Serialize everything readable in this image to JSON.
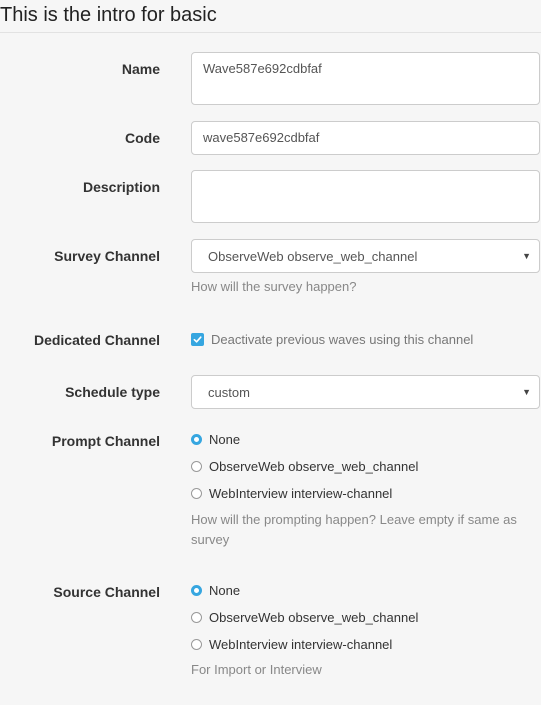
{
  "header": {
    "title": "This is the intro for basic"
  },
  "form": {
    "name": {
      "label": "Name",
      "value": "Wave587e692cdbfaf"
    },
    "code": {
      "label": "Code",
      "value": "wave587e692cdbfaf"
    },
    "description": {
      "label": "Description",
      "value": ""
    },
    "survey_channel": {
      "label": "Survey Channel",
      "selected": "ObserveWeb observe_web_channel",
      "help": "How will the survey happen?"
    },
    "dedicated_channel": {
      "label": "Dedicated Channel",
      "checkbox_label": "Deactivate previous waves using this channel",
      "checked": true
    },
    "schedule_type": {
      "label": "Schedule type",
      "selected": "custom"
    },
    "prompt_channel": {
      "label": "Prompt Channel",
      "options": [
        "None",
        "ObserveWeb observe_web_channel",
        "WebInterview interview-channel"
      ],
      "selected_index": 0,
      "help": "How will the prompting happen? Leave empty if same as survey"
    },
    "source_channel": {
      "label": "Source Channel",
      "options": [
        "None",
        "ObserveWeb observe_web_channel",
        "WebInterview interview-channel"
      ],
      "selected_index": 0,
      "help": "For Import or Interview"
    }
  },
  "icons": {
    "select_caret": "caret-down-icon",
    "checkbox_mark": "checkmark-icon"
  },
  "colors": {
    "accent": "#36a6e0",
    "help_text": "#888888",
    "background": "#f6f6f6"
  }
}
